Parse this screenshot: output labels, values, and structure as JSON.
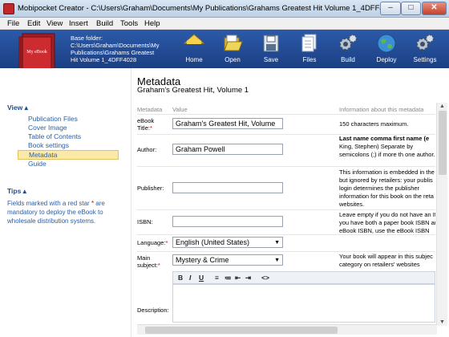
{
  "window": {
    "title": "Mobipocket Creator - C:\\Users\\Graham\\Documents\\My Publications\\Grahams Greatest Hit Volume 1_4DFF4028...",
    "minimize": "–",
    "maximize": "□",
    "close": "✕"
  },
  "menu": [
    "File",
    "Edit",
    "View",
    "Insert",
    "Build",
    "Tools",
    "Help"
  ],
  "book_label": "My eBook",
  "folder": {
    "label": "Base folder:",
    "path_line1": "C:\\Users\\Graham\\Documents\\My",
    "path_line2": "Publications\\Grahams Greatest",
    "path_line3": "Hit Volume 1_4DFF4028"
  },
  "toolbar": [
    {
      "label": "Home",
      "icon": "home-icon"
    },
    {
      "label": "Open",
      "icon": "open-folder-icon"
    },
    {
      "label": "Save",
      "icon": "save-disk-icon"
    },
    {
      "label": "Files",
      "icon": "files-icon"
    },
    {
      "label": "Build",
      "icon": "build-gears-icon"
    },
    {
      "label": "Deploy",
      "icon": "deploy-globe-icon"
    },
    {
      "label": "Settings",
      "icon": "settings-gears-icon"
    }
  ],
  "sidebar": {
    "view_heading": "View ▴",
    "items": [
      "Publication Files",
      "Cover Image",
      "Table of Contents",
      "Book settings",
      "Metadata",
      "Guide"
    ],
    "active_item": "Metadata",
    "tips_heading": "Tips ▴",
    "tips_text_before": "Fields marked with a red star ",
    "tips_star": "*",
    "tips_text_after": " are mandatory to deploy the eBook to wholesale distribution systems."
  },
  "page": {
    "heading": "Metadata",
    "subheading": "Graham's Greatest Hit, Volume 1"
  },
  "columns": {
    "metadata": "Metadata",
    "value": "Value",
    "info": "Information about this metadata"
  },
  "rows": {
    "title": {
      "label": "eBook Title:",
      "star": "*",
      "value": "Graham's Greatest Hit, Volume",
      "info": "150 characters maximum."
    },
    "author": {
      "label": "Author:",
      "value": "Graham Powell",
      "info_bold": "Last name comma first name (e",
      "info": "King, Stephen) Separate by semicolons (;) if more th one author."
    },
    "publisher": {
      "label": "Publisher:",
      "value": "",
      "info": "This information is embedded in the but ignored by retailers: your publis login determines the publisher information for this book on the reta websites."
    },
    "isbn": {
      "label": "ISBN:",
      "value": "",
      "info": "Leave empty if you do not have an If you have both a paper book ISBN an eBook ISBN, use the eBook ISBN"
    },
    "language": {
      "label": "Language:",
      "star": "*",
      "value": "English (United States)"
    },
    "subject": {
      "label": "Main subject:",
      "star": "*",
      "value": "Mystery & Crime",
      "info": "Your book will appear in this subjec category on retailers' websites"
    },
    "description": {
      "label": "Description:"
    }
  },
  "editor_toolbar": {
    "bold": "B",
    "italic": "I",
    "underline": "U",
    "ol": "≡",
    "ul": "≔",
    "outdent": "⇤",
    "indent": "⇥",
    "source": "<>"
  }
}
